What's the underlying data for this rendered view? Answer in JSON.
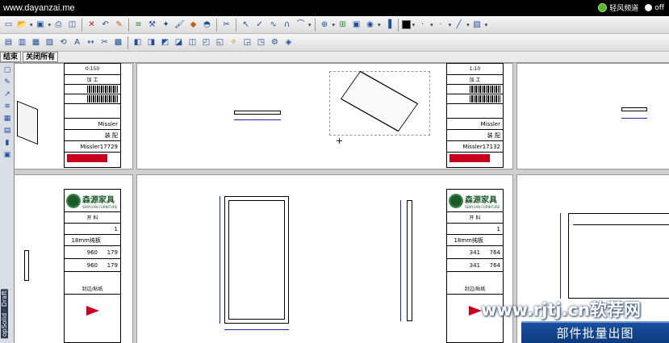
{
  "titlebar": {
    "brand": "www.dayanzai.me",
    "channel_label": "轻风频道",
    "toggle_label": "off"
  },
  "toolbar1": {
    "icons": [
      "new-file-icon",
      "open-folder-icon",
      "save-icon",
      "print-icon",
      "preview-icon",
      "delete-icon",
      "undo-icon",
      "paint-icon",
      "layers-icon",
      "tools-icon",
      "wand-icon",
      "brush-icon",
      "bucket-icon",
      "eraser-icon",
      "scissors-icon",
      "arrow-icon",
      "check-icon",
      "curve-icon",
      "magnet-icon",
      "zoom-icon",
      "zoom-fit-icon",
      "view-icon",
      "pan-icon",
      "color-icon"
    ],
    "colors": {
      "fill": "#000000"
    }
  },
  "toolbar2": {
    "icons": [
      "sheet-icon",
      "sheet-add-icon",
      "sheet-copy-icon",
      "sheet-move-icon",
      "sheet-rotate-icon",
      "sheet-text-icon",
      "sheet-dim-icon",
      "sheet-cut-icon",
      "sheet-lock-icon",
      "view-a-icon",
      "view-b-icon",
      "view-c-icon",
      "view-d-icon",
      "view-e-icon",
      "view-f-icon",
      "view-g-icon",
      "view-h-icon",
      "view-i-icon",
      "view-j-icon",
      "view-k-icon",
      "view-l-icon"
    ]
  },
  "tabs": {
    "end": "结束",
    "close_all": "关闭所有"
  },
  "sidebar": {
    "vertical_label": "opSolid · Draft"
  },
  "sheets": {
    "top_left": {
      "scale": "0:150",
      "process": "加 工",
      "customer": "Missler",
      "product": "装 配",
      "part_no": "Missler17729"
    },
    "top_right": {
      "scale": "1:10",
      "process": "加 工",
      "customer": "Missler",
      "product": "装 配",
      "part_no": "Missler17132"
    },
    "bottom_left": {
      "brand_cn": "森源家具",
      "brand_en": "SENYUAN FURNITURE",
      "section": "开 料",
      "material": "18mm纯板",
      "qty": "1",
      "size1": "960",
      "size1b": "179",
      "size2": "960",
      "size2b": "179",
      "edge": "封边/贴纸"
    },
    "bottom_right": {
      "brand_cn": "森源家具",
      "brand_en": "SENYUAN FURNITURE",
      "section": "开 料",
      "material": "18mm纯板",
      "qty": "1",
      "size1": "341",
      "size1b": "764",
      "size2": "341",
      "size2b": "764",
      "edge": "封边/贴纸"
    }
  },
  "watermark": "www.rjtj.cn软荐网",
  "banner": "部件批量出图"
}
